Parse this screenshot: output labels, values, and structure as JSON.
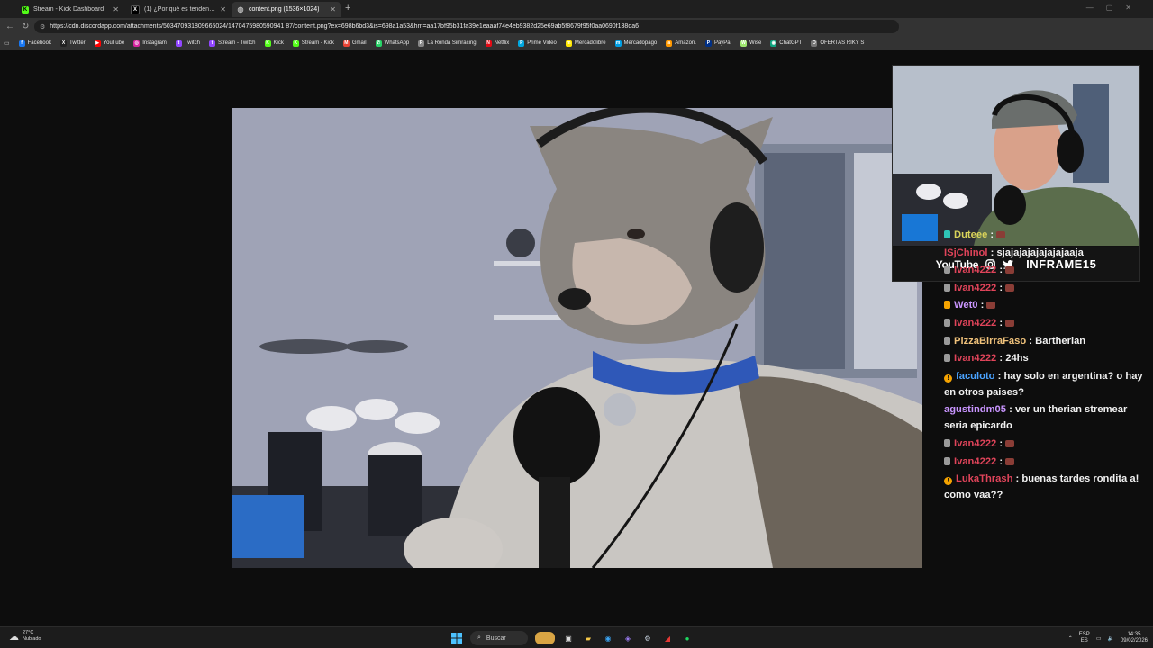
{
  "browser": {
    "tabs": [
      {
        "label": "Stream - Kick Dashboard",
        "favicon": "kick-icon",
        "active": false
      },
      {
        "label": "(1) ¿Por qué es tendencia? (@pon",
        "favicon": "x-icon",
        "active": false
      },
      {
        "label": "content.png (1536×1024)",
        "favicon": "globe-icon",
        "active": true
      }
    ],
    "new_tab": "+",
    "url": "https://cdn.discordapp.com/attachments/503470931809665024/1470475980590941 87/content.png?ex=698b6bd3&is=698a1a53&hm=aa17bf95b31fa39e1eaaaf74e4eb9382d25e69ab5f8679f95f0aa0690f138da6",
    "bookmarks": [
      {
        "label": "Facebook",
        "color": "#1877f2",
        "glyph": "f"
      },
      {
        "label": "Twitter",
        "color": "#222222",
        "glyph": "X"
      },
      {
        "label": "YouTube",
        "color": "#ff0000",
        "glyph": "▶"
      },
      {
        "label": "Instagram",
        "color": "#d6249f",
        "glyph": "◎"
      },
      {
        "label": "Twitch",
        "color": "#9146ff",
        "glyph": "t"
      },
      {
        "label": "Stream - Twitch",
        "color": "#9146ff",
        "glyph": "t"
      },
      {
        "label": "Kick",
        "color": "#53fc18",
        "glyph": "K"
      },
      {
        "label": "Stream - Kick",
        "color": "#53fc18",
        "glyph": "K"
      },
      {
        "label": "Gmail",
        "color": "#ea4335",
        "glyph": "M"
      },
      {
        "label": "WhatsApp",
        "color": "#25d366",
        "glyph": "✆"
      },
      {
        "label": "La Ronda Simracing",
        "color": "#888888",
        "glyph": "R"
      },
      {
        "label": "Netflix",
        "color": "#e50914",
        "glyph": "N"
      },
      {
        "label": "Prime Video",
        "color": "#00a8e1",
        "glyph": "P"
      },
      {
        "label": "Mercadolibre",
        "color": "#ffe600",
        "glyph": "m"
      },
      {
        "label": "Mercadopago",
        "color": "#009ee3",
        "glyph": "m"
      },
      {
        "label": "Amazon.",
        "color": "#ff9900",
        "glyph": "a"
      },
      {
        "label": "PayPal",
        "color": "#003087",
        "glyph": "P"
      },
      {
        "label": "Wise",
        "color": "#9fe870",
        "glyph": "W"
      },
      {
        "label": "ChatGPT",
        "color": "#10a37f",
        "glyph": "◉"
      },
      {
        "label": "OFERTAS RIKY S",
        "color": "#777777",
        "glyph": "O"
      }
    ]
  },
  "overlay": {
    "youtube_label": "YouTube",
    "handle": "INFRAME15"
  },
  "chat": [
    {
      "badge": "#2ec4b6",
      "user": "Duteee",
      "user_color": "#d9d35a",
      "text": "",
      "emote": true
    },
    {
      "badge": "",
      "user": "ISjChinol",
      "user_color": "#e0445a",
      "text": "sjajajajajajajajaaja",
      "emote": false
    },
    {
      "badge": "#9a9a9a",
      "user": "Ivan4222",
      "user_color": "#e0445a",
      "text": "",
      "emote": true
    },
    {
      "badge": "#9a9a9a",
      "user": "Ivan4222",
      "user_color": "#e0445a",
      "text": "",
      "emote": true
    },
    {
      "badge": "#f5a300",
      "user": "Wet0",
      "user_color": "#c995ff",
      "text": "",
      "emote": true
    },
    {
      "badge": "#9a9a9a",
      "user": "Ivan4222",
      "user_color": "#e0445a",
      "text": "",
      "emote": true
    },
    {
      "badge": "#9a9a9a",
      "user": "PizzaBirraFaso",
      "user_color": "#f0c27b",
      "text": "Bartherian",
      "emote": false
    },
    {
      "badge": "#9a9a9a",
      "user": "Ivan4222",
      "user_color": "#e0445a",
      "text": "24hs",
      "emote": false
    },
    {
      "badge": "info",
      "user": "faculoto",
      "user_color": "#4aa3ff",
      "text": "hay solo en argentina? o hay en otros paises?",
      "emote": false
    },
    {
      "badge": "",
      "user": "agustindm05",
      "user_color": "#c995ff",
      "text": "ver un therian stremear seria epicardo",
      "emote": false
    },
    {
      "badge": "#9a9a9a",
      "user": "Ivan4222",
      "user_color": "#e0445a",
      "text": "",
      "emote": true
    },
    {
      "badge": "#9a9a9a",
      "user": "Ivan4222",
      "user_color": "#e0445a",
      "text": "",
      "emote": true
    },
    {
      "badge": "info",
      "user": "LukaThrash",
      "user_color": "#e0445a",
      "text": "buenas tardes rondita a! como vaa??",
      "emote": false
    }
  ],
  "taskbar": {
    "weather_temp": "27°C",
    "weather_desc": "Nublado",
    "search_label": "Buscar",
    "lang_top": "ESP",
    "lang_bottom": "ES",
    "time": "14:35",
    "date": "09/02/2026"
  }
}
